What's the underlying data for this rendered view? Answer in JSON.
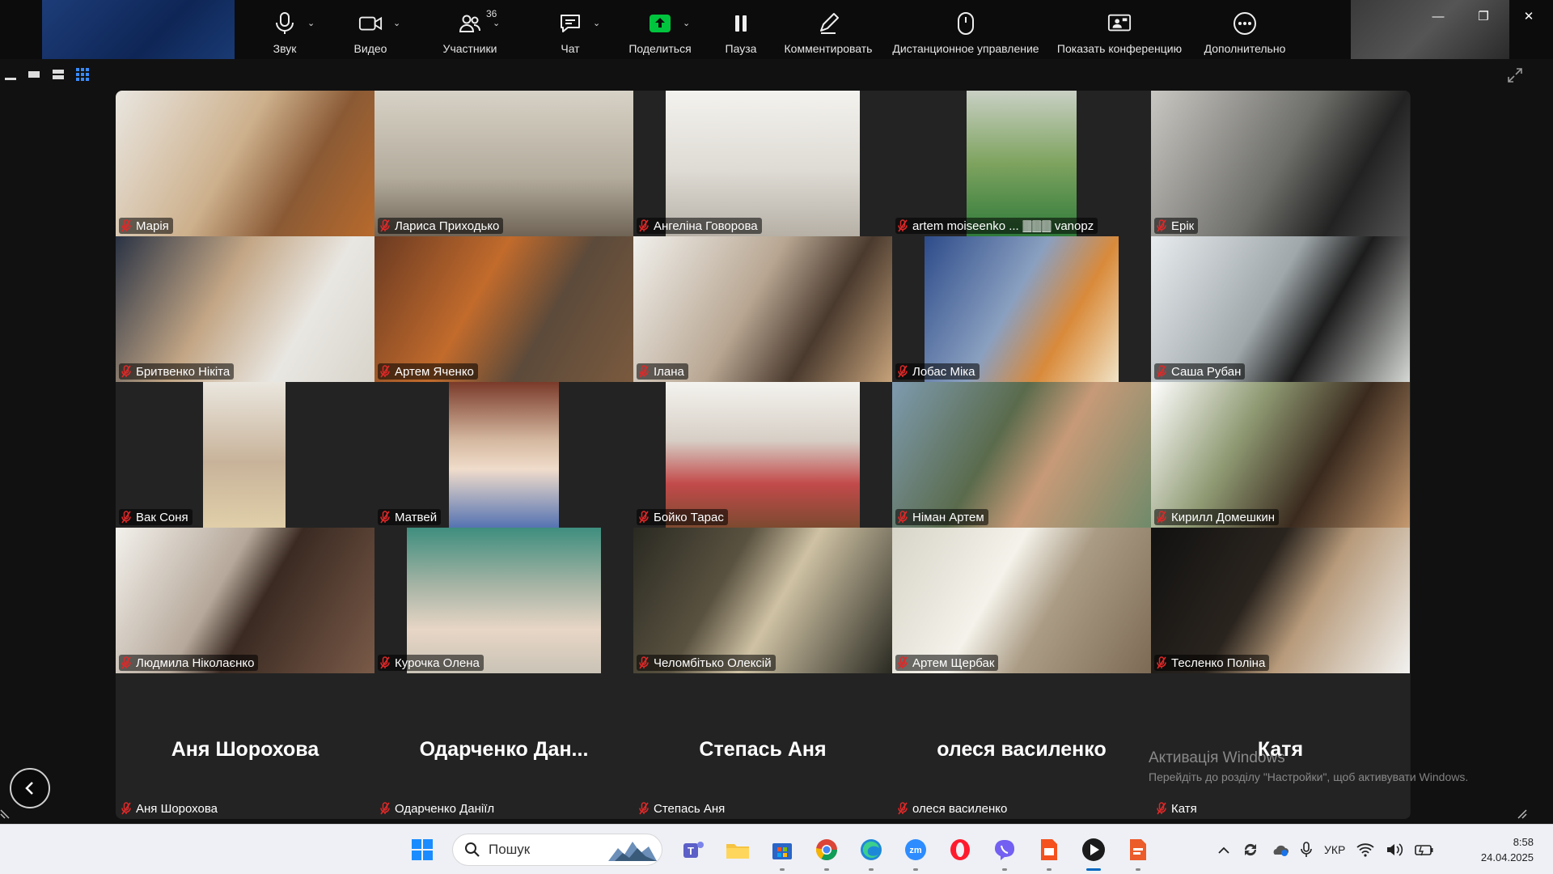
{
  "toolbar": {
    "items": [
      {
        "label": "Звук",
        "icon": "microphone-icon",
        "caret": true
      },
      {
        "label": "Видео",
        "icon": "video-camera-icon",
        "caret": true
      },
      {
        "label": "Участники",
        "icon": "participants-icon",
        "caret": true,
        "badge": "36"
      },
      {
        "label": "Чат",
        "icon": "chat-icon",
        "caret": true
      },
      {
        "label": "Поделиться",
        "icon": "share-screen-icon",
        "caret": true,
        "accent": "#00c43d"
      },
      {
        "label": "Пауза",
        "icon": "pause-icon"
      },
      {
        "label": "Комментировать",
        "icon": "annotate-pen-icon"
      },
      {
        "label": "Дистанционное управление",
        "icon": "remote-control-icon"
      },
      {
        "label": "Показать конференцию",
        "icon": "show-meeting-icon"
      },
      {
        "label": "Дополнительно",
        "icon": "more-icon"
      }
    ]
  },
  "window": {
    "minimize": "—",
    "restore": "❐",
    "close": "✕"
  },
  "participants": [
    {
      "name": "Марія",
      "muted": true
    },
    {
      "name": "Лариса Приходько",
      "muted": true
    },
    {
      "name": "Ангеліна Говорова",
      "muted": true
    },
    {
      "name": "artem moiseenko ... 🀫🀫🀫 vanopz",
      "muted": true
    },
    {
      "name": "Ерік",
      "muted": true
    },
    {
      "name": "Бритвенко Нікіта",
      "muted": true
    },
    {
      "name": "Артем Яченко",
      "muted": true
    },
    {
      "name": "Ілана",
      "muted": true
    },
    {
      "name": "Лобас Міка",
      "muted": true
    },
    {
      "name": "Саша Рубан",
      "muted": true
    },
    {
      "name": "Вак Соня",
      "muted": true
    },
    {
      "name": "Матвей",
      "muted": true
    },
    {
      "name": "Бойко Тарас",
      "muted": true
    },
    {
      "name": "Німан Артем",
      "muted": true
    },
    {
      "name": "Кирилл Домешкин",
      "muted": true
    },
    {
      "name": "Людмила Ніколаєнко",
      "muted": true
    },
    {
      "name": "Курочка Олена",
      "muted": true
    },
    {
      "name": "Челомбітько Олексій",
      "muted": true
    },
    {
      "name": "Артем Щербак",
      "muted": true
    },
    {
      "name": "Тесленко Поліна",
      "muted": true
    }
  ],
  "audio_only": [
    {
      "display": "Аня Шорохова",
      "name": "Аня Шорохова"
    },
    {
      "display": "Одарченко  Дан...",
      "name": "Одарченко Даніїл"
    },
    {
      "display": "Степась Аня",
      "name": "Степась Аня"
    },
    {
      "display": "олеся василенко",
      "name": "олеся василенко"
    },
    {
      "display": "Катя",
      "name": "Катя"
    }
  ],
  "watermark": {
    "line1": "Активація Windows",
    "line2": "Перейдіть до розділу \"Настройки\", щоб активувати Windows."
  },
  "taskbar": {
    "search_placeholder": "Пошук",
    "language": "УКР",
    "time": "8:58",
    "date": "24.04.2025",
    "apps": [
      "start-icon",
      "search",
      "teams-icon",
      "file-explorer-icon",
      "microsoft-store-icon",
      "chrome-icon",
      "edge-icon",
      "zoom-icon",
      "opera-icon",
      "viber-icon",
      "slides-icon",
      "media-player-icon",
      "pdf-icon"
    ]
  },
  "colors": {
    "muted_mic": "#e02828",
    "share_accent": "#00c43d",
    "tile_bg": "#232323"
  }
}
